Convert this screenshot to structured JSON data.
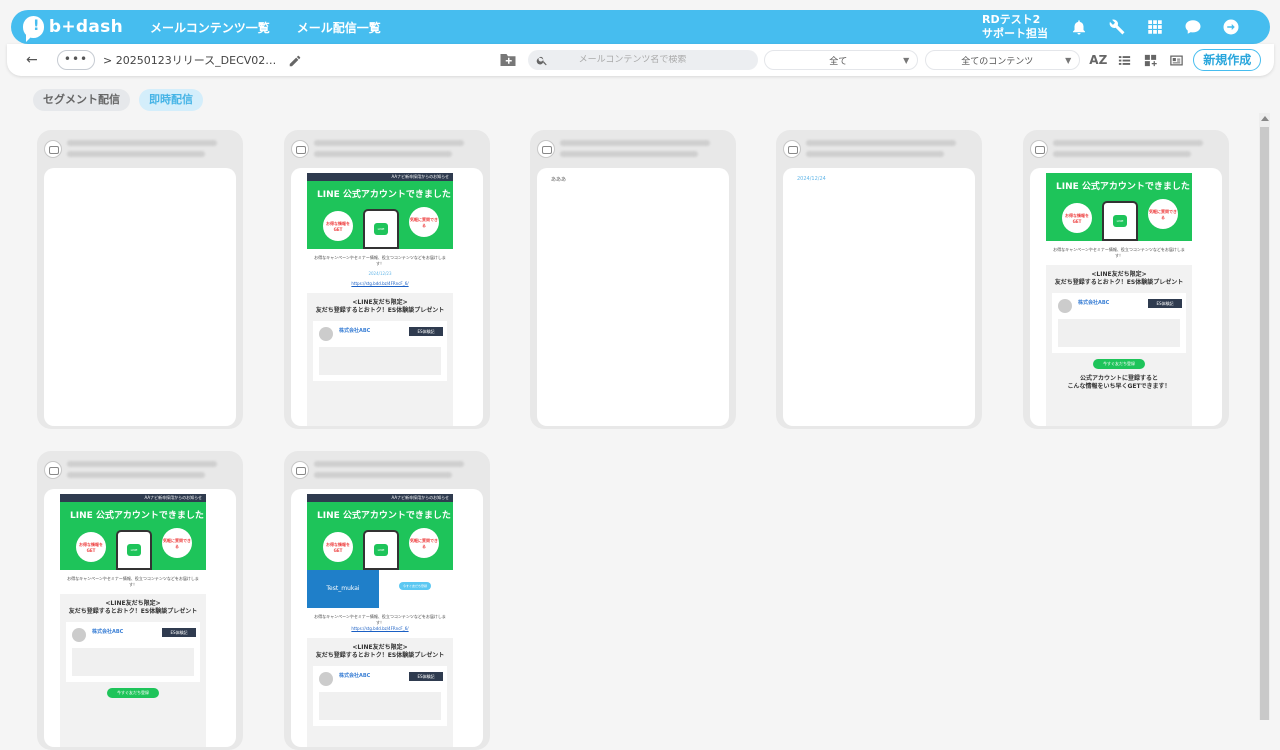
{
  "app": {
    "logo_text": "b+dash",
    "nav": [
      "メールコンテンツ一覧",
      "メール配信一覧"
    ],
    "user_line1": "RDテスト2",
    "user_line2": "サポート担当"
  },
  "toolbar": {
    "more_label": "•••",
    "breadcrumb": "> 20250123リリース_DECV02…",
    "search_placeholder": "メールコンテンツ名で検索",
    "filter1": "全て",
    "filter2": "全てのコンテンツ",
    "sort_label": "AZ",
    "new_button": "新規作成"
  },
  "tabs": [
    {
      "label": "セグメント配信",
      "active": false
    },
    {
      "label": "即時配信",
      "active": true
    }
  ],
  "newsletter": {
    "top_bar": "AAナビ新卒採用からのお知らせ",
    "hero_title": "LINE 公式アカウントできました",
    "circle_left": "お得な情報をGET",
    "circle_right": "気軽に質問できる",
    "intro": "お得なキャンペーンやセミナー情報、役立つコンテンツなどをお届けします！",
    "promo_title_1": "<LINE友だち限定>",
    "promo_title_2": "友だち登録するとおトク！ES体験談プレゼント",
    "company": "株式会社ABC",
    "tag": "ES体験記",
    "cta": "今すぐ友だち登録",
    "footer_title": "公式アカウントに登録すると",
    "footer_sub": "こんな情報をいち早くGETできます！",
    "test_block": "Test_mukai",
    "date": "2024/12/23",
    "link": "https://stg.bdd.bz/4FRncF_6/",
    "aaa": "あああ",
    "blue_date": "2024/12/24"
  }
}
